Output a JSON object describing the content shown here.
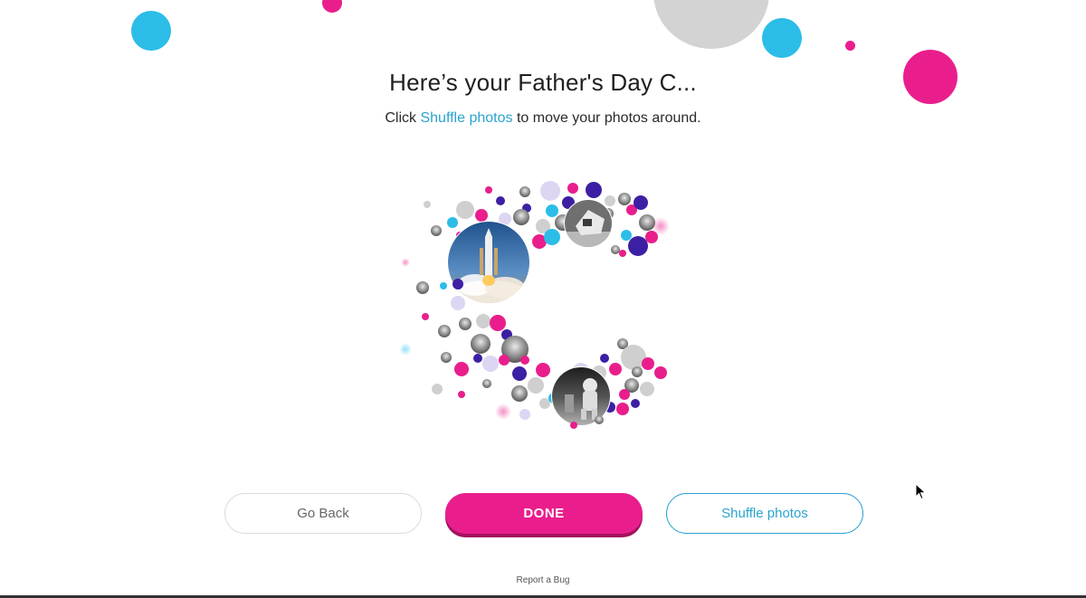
{
  "header": {
    "title": "Here’s your Father's Day C...",
    "subtitle_prefix": "Click ",
    "subtitle_link": "Shuffle photos",
    "subtitle_suffix": " to move your photos around."
  },
  "collage": {
    "letter": "C",
    "photo_subjects": [
      "rocket-launch-photo",
      "astronaut-moon-photo",
      "lunar-module-photo"
    ]
  },
  "actions": {
    "back_label": "Go Back",
    "done_label": "DONE",
    "shuffle_label": "Shuffle photos"
  },
  "footer": {
    "report_label": "Report a Bug"
  },
  "colors": {
    "pink": "#e91e8c",
    "cyan": "#2bbde8",
    "purple": "#3d1fa3",
    "gray": "#cfcfcf",
    "link": "#2aa3cf"
  }
}
